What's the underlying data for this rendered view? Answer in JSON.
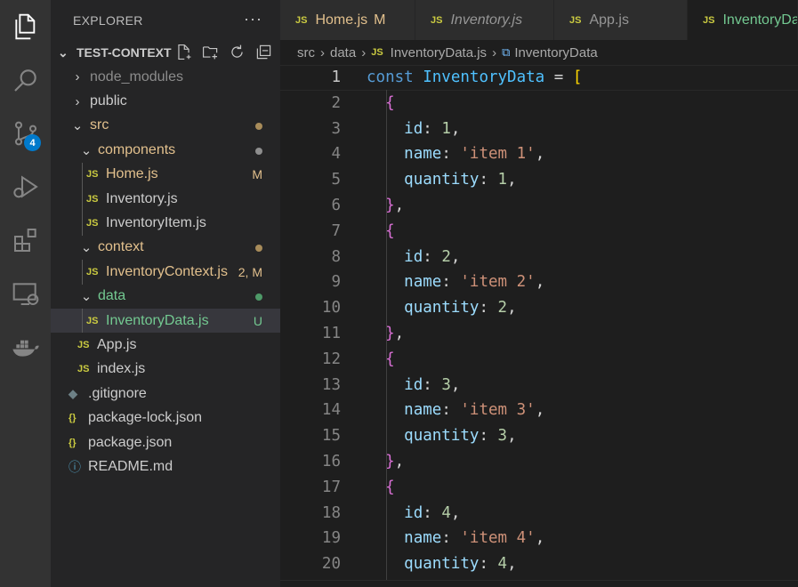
{
  "activity_bar": {
    "icons": [
      "explorer-icon",
      "search-icon",
      "source-control-icon",
      "run-debug-icon",
      "extensions-icon",
      "remote-explorer-icon",
      "docker-icon"
    ],
    "source_control_badge": "4"
  },
  "sidebar": {
    "header": "EXPLORER",
    "more": "···",
    "project": "TEST-CONTEXT",
    "tree": {
      "node_modules": "node_modules",
      "public": "public",
      "src": "src",
      "components": "components",
      "home": "Home.js",
      "home_status": "M",
      "inventory": "Inventory.js",
      "inventory_item": "InventoryItem.js",
      "context": "context",
      "inventory_context": "InventoryContext.js",
      "inventory_context_status": "2, M",
      "data": "data",
      "inventory_data": "InventoryData.js",
      "inventory_data_status": "U",
      "app": "App.js",
      "index": "index.js",
      "gitignore": ".gitignore",
      "package_lock": "package-lock.json",
      "package": "package.json",
      "readme": "README.md"
    },
    "js_icon": "JS",
    "json_icon": "{}"
  },
  "tabs": [
    {
      "label": "Home.js",
      "status": "M"
    },
    {
      "label": "Inventory.js",
      "status": ""
    },
    {
      "label": "App.js",
      "status": ""
    },
    {
      "label": "InventoryData.js",
      "status": ""
    }
  ],
  "breadcrumb": {
    "part1": "src",
    "part2": "data",
    "file": "InventoryData.js",
    "symbol": "InventoryData"
  },
  "editor": {
    "line_numbers": [
      "1",
      "2",
      "3",
      "4",
      "5",
      "6",
      "7",
      "8",
      "9",
      "10",
      "11",
      "12",
      "13",
      "14",
      "15",
      "16",
      "17",
      "18",
      "19",
      "20"
    ],
    "items": [
      {
        "id": "1",
        "name": "'item 1'",
        "quantity": "1"
      },
      {
        "id": "2",
        "name": "'item 2'",
        "quantity": "2"
      },
      {
        "id": "3",
        "name": "'item 3'",
        "quantity": "3"
      },
      {
        "id": "4",
        "name": "'item 4'",
        "quantity": "4"
      }
    ],
    "line1": {
      "kw": "const",
      "name": "InventoryData",
      "eq": " = ",
      "bracket": "["
    }
  },
  "colors": {
    "modified": "#e2c08d",
    "untracked": "#73c991",
    "accent": "#007acc"
  }
}
